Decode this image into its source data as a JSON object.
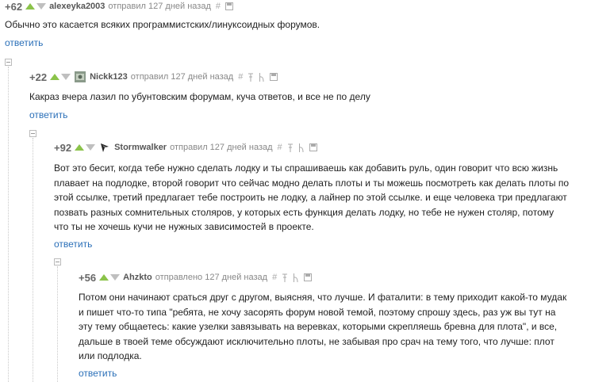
{
  "comments": [
    {
      "rating": "+62",
      "username": "alexeyka2003",
      "posted_text": "отправил 127 дней назад",
      "body": "Обычно это касается всяких программистских/линуксоидных форумов.",
      "reply_label": "ответить"
    },
    {
      "rating": "+22",
      "username": "Nickk123",
      "posted_text": "отправил 127 дней назад",
      "body": "Какраз вчера лазил по убунтовским форумам, куча ответов, и все не по делу",
      "reply_label": "ответить"
    },
    {
      "rating": "+92",
      "username": "Stormwalker",
      "posted_text": "отправил 127 дней назад",
      "body_lines": [
        "Вот это бесит, когда тебе нужно сделать лодку и ты спрашиваешь как добавить руль, один говорит что всю жизнь",
        "плавает на подлодке, второй говорит что сейчас модно делать плоты и ты можешь посмотреть как делать плоты по",
        "этой ссылке, третий предлагает тебе построить не лодку, а лайнер по этой ссылке. и еще человека три предлагают",
        "позвать разных сомнительных столяров, у которых есть функция делать лодку, но тебе не нужен столяр, потому",
        "что ты не хочешь кучи не нужных зависимостей в проекте."
      ],
      "reply_label": "ответить"
    },
    {
      "rating": "+56",
      "username": "Ahzkto",
      "posted_text": "отправлено 127 дней назад",
      "body_lines": [
        "Потом они начинают сраться друг с другом, выясняя, что лучше. И фаталити: в тему приходит какой-то мудак",
        "и пишет что-то типа \"ребята, не хочу засорять форум новой темой, поэтому спрошу здесь, раз уж вы тут на",
        "эту тему общаетесь: какие узелки завязывать на веревках, которыми скрепляешь бревна для плота\", и все,",
        "дальше в твоей теме обсуждают исключительно плоты, не забывая про срач на тему того, что лучше: плот",
        "или подлодка."
      ],
      "reply_label": "ответить"
    }
  ],
  "icons": [
    "hash-icon",
    "pin-icon",
    "user-icon",
    "save-icon"
  ],
  "colors": {
    "vote_up": "#8bc34a",
    "vote_down": "#bfbfbf",
    "link": "#2a6fb8",
    "meta": "#888888"
  }
}
